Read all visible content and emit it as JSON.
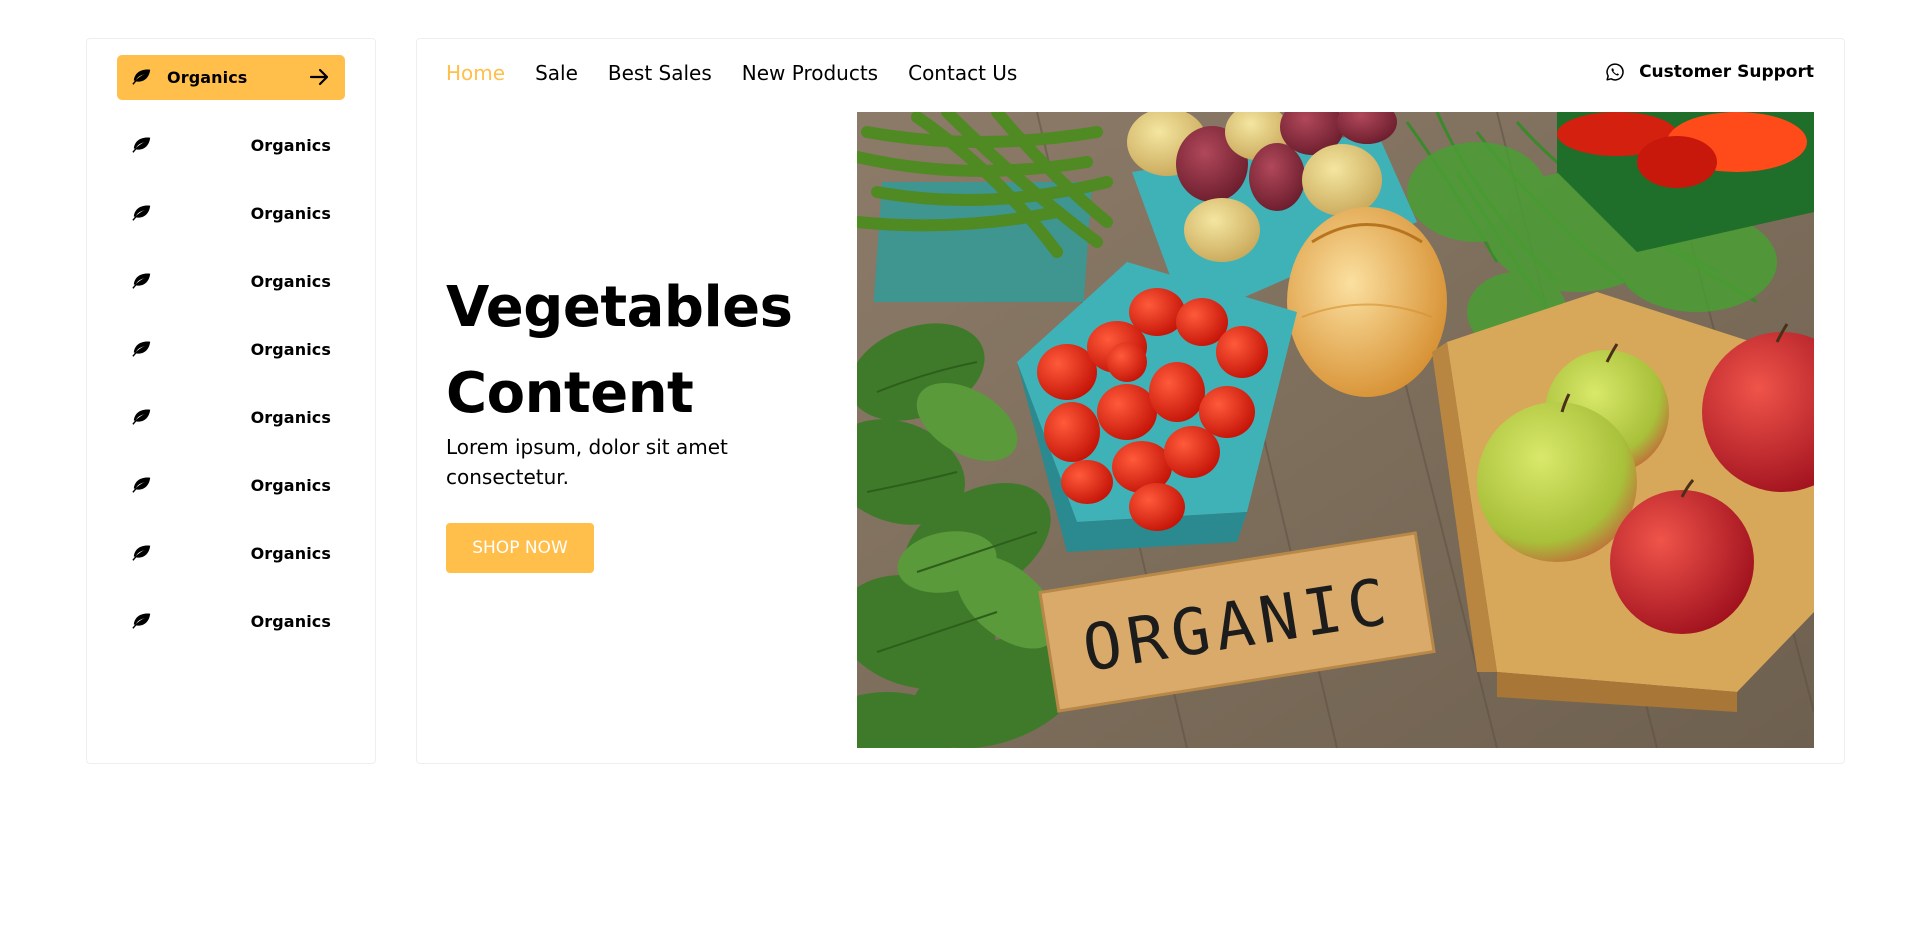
{
  "sidebar": {
    "items": [
      {
        "label": "Organics",
        "icon": "leaf-icon",
        "active": true
      },
      {
        "label": "Organics",
        "icon": "leaf-icon"
      },
      {
        "label": "Organics",
        "icon": "leaf-icon"
      },
      {
        "label": "Organics",
        "icon": "leaf-icon"
      },
      {
        "label": "Organics",
        "icon": "leaf-icon"
      },
      {
        "label": "Organics",
        "icon": "leaf-icon"
      },
      {
        "label": "Organics",
        "icon": "leaf-icon"
      },
      {
        "label": "Organics",
        "icon": "leaf-icon"
      },
      {
        "label": "Organics",
        "icon": "leaf-icon"
      }
    ],
    "active_icon_right": "arrow-right-icon"
  },
  "nav": {
    "links": [
      "Home",
      "Sale",
      "Best Sales",
      "New Products",
      "Contact Us"
    ],
    "current": "Home"
  },
  "support": {
    "label": "Customer Support",
    "icon": "whatsapp-icon"
  },
  "hero": {
    "title_line1": "Vegetables",
    "title_line2": "Content",
    "subtitle": "Lorem ipsum, dolor sit amet consectetur.",
    "button_label": "SHOP NOW",
    "sign_text": "ORGANIC"
  },
  "colors": {
    "accent": "#ffbf4a",
    "text": "#000000",
    "border": "#eeeeee",
    "background": "#ffffff"
  }
}
